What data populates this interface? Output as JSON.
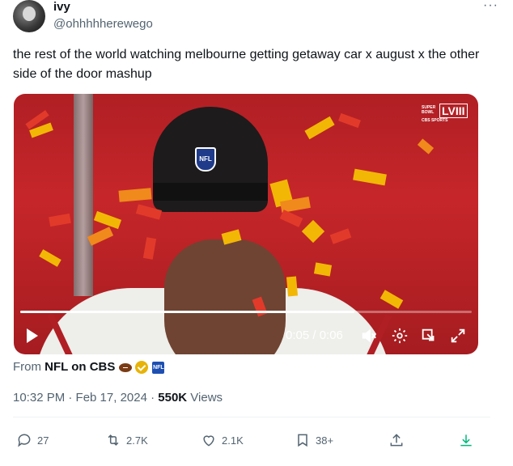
{
  "author": {
    "name": "ivy",
    "handle": "@ohhhhherewego"
  },
  "tweet": {
    "text": "the rest of the world watching melbourne getting getaway car x august x the other side of the door mashup"
  },
  "video": {
    "overlay_logo_top": "SUPER BOWL",
    "overlay_logo_num": "LVIII",
    "overlay_logo_bottom": "CBS SPORTS",
    "helmet_logo": "NFL",
    "time_display": "0:05 / 0:06",
    "progress_fraction": 0.74
  },
  "source": {
    "prefix": "From",
    "account": "NFL on CBS",
    "org_badge_text": "NFL"
  },
  "meta": {
    "timestamp": "10:32 PM · Feb 17, 2024 · ",
    "views_count": "550K",
    "views_label": " Views"
  },
  "actions": {
    "replies": "27",
    "reposts": "2.7K",
    "likes": "2.1K",
    "bookmarks": "38+"
  },
  "colors": {
    "text_primary": "#0f1419",
    "text_secondary": "#536471",
    "video_bg": "#b01f24",
    "verified_gold": "#e8b308",
    "org_blue": "#1d4fb2"
  }
}
